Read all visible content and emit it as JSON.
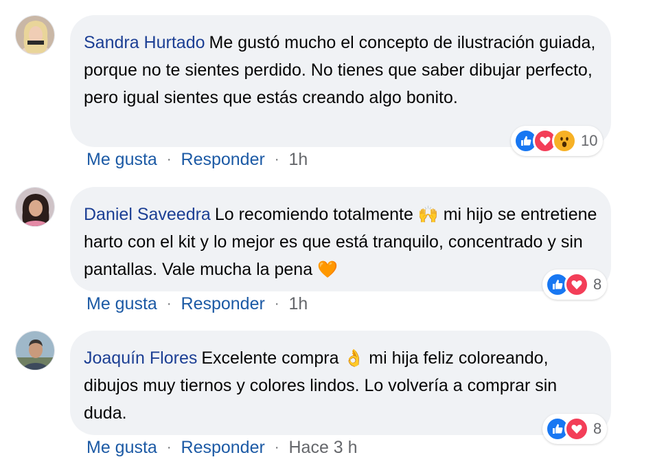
{
  "comments": [
    {
      "author": "Sandra Hurtado",
      "text": "Me gustó mucho el concepto de ilustración guiada, porque no te sientes perdido. No tienes que saber dibujar perfecto, pero igual sientes que estás creando algo bonito.",
      "reactions": [
        "like",
        "love",
        "wow"
      ],
      "reaction_count": "10",
      "like_label": "Me gusta",
      "reply_label": "Responder",
      "time": "1h"
    },
    {
      "author": "Daniel Saveedra",
      "text_before": "Lo recomiendo totalmente",
      "emoji1": "🙌",
      "text_middle": "mi hijo se entretiene harto con el kit y lo mejor es que está tranquilo, concentrado y sin pantallas. Vale mucha la pena",
      "emoji2": "🧡",
      "reactions": [
        "like",
        "love"
      ],
      "reaction_count": "8",
      "like_label": "Me gusta",
      "reply_label": "Responder",
      "time": "1h"
    },
    {
      "author": "Joaquín Flores",
      "text_before": "Excelente compra",
      "emoji1": "👌",
      "text_after": "mi hija feliz coloreando, dibujos muy tiernos y colores lindos. Lo volvería a comprar sin duda.",
      "reactions": [
        "like",
        "love"
      ],
      "reaction_count": "8",
      "like_label": "Me gusta",
      "reply_label": "Responder",
      "time": "Hace 3 h"
    }
  ],
  "colors": {
    "bubble": "#f0f2f5",
    "author": "#1c3f94",
    "link": "#1c5aa5",
    "muted": "#65676b",
    "like": "#1877f2",
    "love": "#f33e58",
    "wow": "#f7b125"
  }
}
